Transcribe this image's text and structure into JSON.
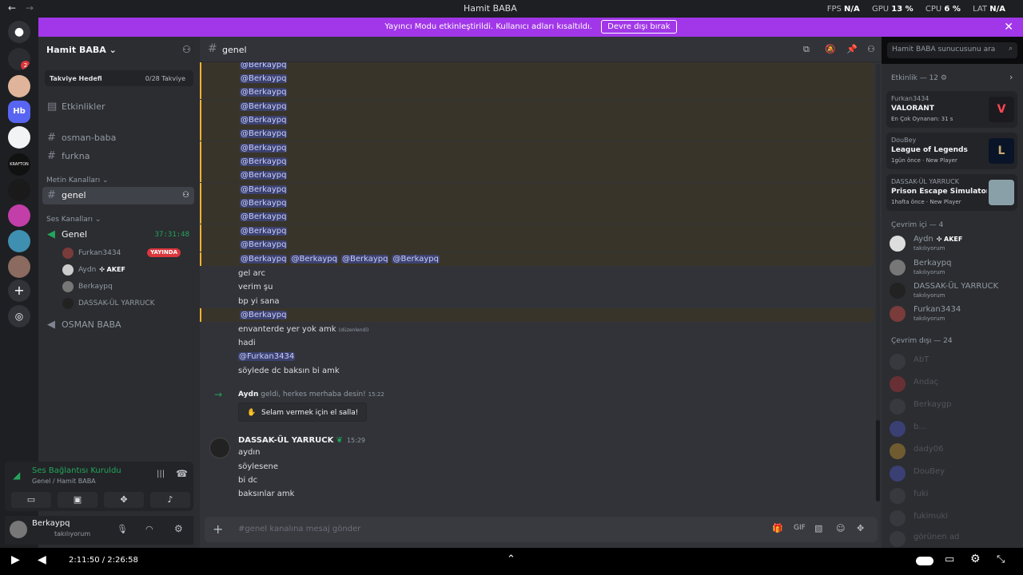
{
  "titlebar": {
    "title": "Hamit BABA",
    "fps_label": "FPS",
    "fps_value": "N/A",
    "gpu_label": "GPU",
    "gpu_value": "13 %",
    "cpu_label": "CPU",
    "cpu_value": "6 %",
    "lat_label": "LAT",
    "lat_value": "N/A"
  },
  "banner": {
    "text": "Yayıncı Modu etkinleştirildi. Kullanıcı adları kısaltıldı.",
    "button": "Devre dışı bırak"
  },
  "servers": {
    "hb_label": "Hb",
    "badge": "2",
    "krafton": "KRAFTON"
  },
  "sidebar": {
    "server_name": "Hamit BABA",
    "boost_label": "Takviye Hedefi",
    "boost_value": "0/28 Takviye",
    "events": "Etkinlikler",
    "channels": [
      "osman-baba",
      "furkna"
    ],
    "text_category": "Metin Kanalları",
    "active_channel": "genel",
    "voice_category": "Ses Kanalları",
    "voice_channel": "Genel",
    "voice_timer": "37:31:48",
    "voice_users": [
      {
        "name": "Furkan3434",
        "badge": "YAYINDA"
      },
      {
        "name": "Aydn",
        "tag": "AKEF"
      },
      {
        "name": "Berkaypq"
      },
      {
        "name": "DASSAK-ÜL YARRUCK"
      }
    ],
    "voice_channel_2": "OSMAN BABA"
  },
  "voice_status": {
    "title": "Ses Bağlantısı Kuruldu",
    "sub": "Genel / Hamit BABA"
  },
  "user": {
    "name": "Berkaypq",
    "status": "takılıyorum"
  },
  "channel_header": {
    "name": "genel",
    "search_placeholder": "Hamit BABA sunucusunu ara"
  },
  "messages": {
    "mention_name": "@Berkaypq",
    "mention_furkan": "@Furkan3434",
    "lines": [
      "gel arc",
      "verim şu",
      "bp yi sana"
    ],
    "env": "envanterde yer yok amk",
    "edited": "(düzenlendi)",
    "hadi": "hadi",
    "soyle": "söylede dc baksın bi amk",
    "join_user": "Aydn",
    "join_text": "geldi, herkes merhaba desin!",
    "join_time": "15:22",
    "wave_button": "Selam vermek için el salla!",
    "author": "DASSAK-ÜL YARRUCK",
    "author_time": "15:29",
    "author_lines": [
      "aydın",
      "söylesene",
      "bi dc",
      "baksınlar amk"
    ]
  },
  "composer": {
    "placeholder": "#genel kanalına mesaj gönder"
  },
  "members": {
    "activity_header": "Etkinlik — 12",
    "activities": [
      {
        "user": "Furkan3434",
        "game": "VALORANT",
        "sub": "En Çok Oynanan: 31 s"
      },
      {
        "user": "DouBey",
        "game": "League of Legends",
        "sub": "1gün önce",
        "tag": "New Player"
      },
      {
        "user": "DASSAK-ÜL YARRUCK",
        "game": "Prison Escape Simulator: D...",
        "sub": "1hafta önce",
        "tag": "New Player"
      }
    ],
    "online_header": "Çevrim içi — 4",
    "online": [
      {
        "name": "Aydn",
        "tag": "AKEF",
        "status": "takılıyorum"
      },
      {
        "name": "Berkaypq",
        "status": "takılıyorum"
      },
      {
        "name": "DASSAK-ÜL YARRUCK",
        "status": "takılıyorum"
      },
      {
        "name": "Furkan3434",
        "status": "takılıyorum"
      }
    ],
    "offline_header": "Çevrim dışı — 24",
    "offline": [
      "AbT",
      "Andaç",
      "Berkaygp",
      "b...",
      "dady06",
      "DouBey",
      "fuki",
      "fukimuki",
      "görünen ad"
    ]
  },
  "player": {
    "time": "2:11:50 / 2:26:58"
  },
  "colors": {
    "accent": "#a137e8",
    "live": "#da373c",
    "mention_bg": "#3c4270",
    "highlight": "#f0b232"
  }
}
